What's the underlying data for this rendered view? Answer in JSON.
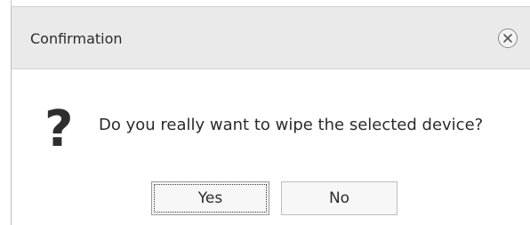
{
  "dialog": {
    "title": "Confirmation",
    "message": "Do you really want to wipe the selected device?",
    "icon": "question-icon",
    "close_icon": "close-icon",
    "buttons": {
      "yes": "Yes",
      "no": "No"
    },
    "focused_button": "yes"
  },
  "colors": {
    "titlebar_bg": "#eaeaea",
    "button_bg": "#f7f7f7",
    "text": "#2b2b2b"
  }
}
